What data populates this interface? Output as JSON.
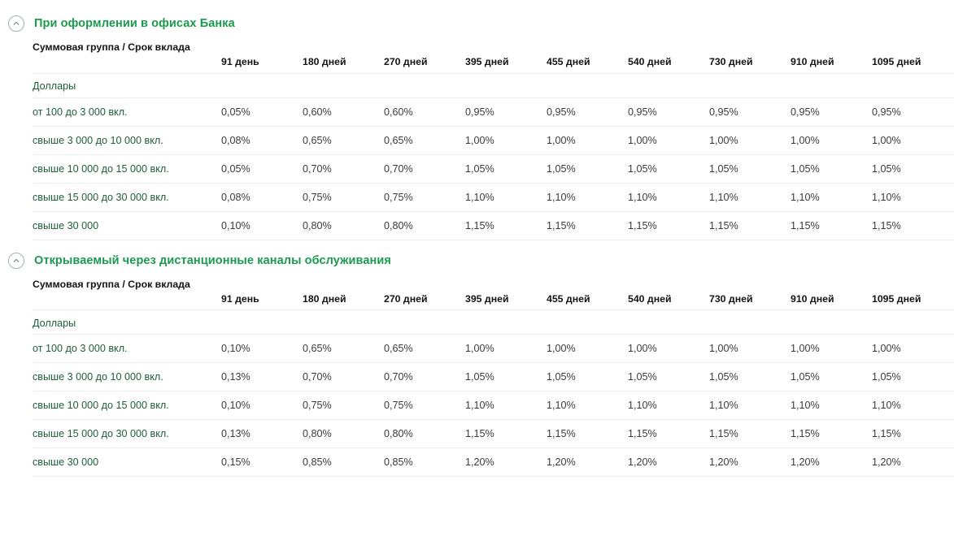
{
  "colors": {
    "heading_green": "#1a9b4c",
    "label_green": "#1d5e3a",
    "value_gray": "#3b3b3b",
    "header_dark": "#141414",
    "row_divider": "#eceff0",
    "icon_border": "#9db9a8"
  },
  "columns": [
    "Суммовая группа / Срок вклада",
    "91 день",
    "180 дней",
    "270 дней",
    "395 дней",
    "455 дней",
    "540 дней",
    "730 дней",
    "910 дней",
    "1095 дней"
  ],
  "sections": [
    {
      "id": "offices",
      "icon": "chevron-up-circle-icon",
      "title": "При оформлении в офисах Банка",
      "table": {
        "header": [
          "Суммовая группа / Срок вклада",
          "91 день",
          "180 дней",
          "270 дней",
          "395 дней",
          "455 дней",
          "540 дней",
          "730 дней",
          "910 дней",
          "1095 дней"
        ],
        "group_label": "Доллары",
        "rows": [
          {
            "label": "от 100 до 3 000 вкл.",
            "values": [
              "0,05%",
              "0,60%",
              "0,60%",
              "0,95%",
              "0,95%",
              "0,95%",
              "0,95%",
              "0,95%",
              "0,95%"
            ]
          },
          {
            "label": "свыше 3 000 до 10 000 вкл.",
            "values": [
              "0,08%",
              "0,65%",
              "0,65%",
              "1,00%",
              "1,00%",
              "1,00%",
              "1,00%",
              "1,00%",
              "1,00%"
            ]
          },
          {
            "label": "свыше 10 000 до 15 000 вкл.",
            "values": [
              "0,05%",
              "0,70%",
              "0,70%",
              "1,05%",
              "1,05%",
              "1,05%",
              "1,05%",
              "1,05%",
              "1,05%"
            ]
          },
          {
            "label": "свыше 15 000 до 30 000 вкл.",
            "values": [
              "0,08%",
              "0,75%",
              "0,75%",
              "1,10%",
              "1,10%",
              "1,10%",
              "1,10%",
              "1,10%",
              "1,10%"
            ]
          },
          {
            "label": "свыше 30 000",
            "values": [
              "0,10%",
              "0,80%",
              "0,80%",
              "1,15%",
              "1,15%",
              "1,15%",
              "1,15%",
              "1,15%",
              "1,15%"
            ]
          }
        ]
      }
    },
    {
      "id": "remote",
      "icon": "chevron-up-circle-icon",
      "title": "Открываемый через дистанционные каналы обслуживания",
      "table": {
        "header": [
          "Суммовая группа / Срок вклада",
          "91 день",
          "180 дней",
          "270 дней",
          "395 дней",
          "455 дней",
          "540 дней",
          "730 дней",
          "910 дней",
          "1095 дней"
        ],
        "group_label": "Доллары",
        "rows": [
          {
            "label": "от 100 до 3 000 вкл.",
            "values": [
              "0,10%",
              "0,65%",
              "0,65%",
              "1,00%",
              "1,00%",
              "1,00%",
              "1,00%",
              "1,00%",
              "1,00%"
            ]
          },
          {
            "label": "свыше 3 000 до 10 000 вкл.",
            "values": [
              "0,13%",
              "0,70%",
              "0,70%",
              "1,05%",
              "1,05%",
              "1,05%",
              "1,05%",
              "1,05%",
              "1,05%"
            ]
          },
          {
            "label": "свыше 10 000 до 15 000 вкл.",
            "values": [
              "0,10%",
              "0,75%",
              "0,75%",
              "1,10%",
              "1,10%",
              "1,10%",
              "1,10%",
              "1,10%",
              "1,10%"
            ]
          },
          {
            "label": "свыше 15 000 до 30 000 вкл.",
            "values": [
              "0,13%",
              "0,80%",
              "0,80%",
              "1,15%",
              "1,15%",
              "1,15%",
              "1,15%",
              "1,15%",
              "1,15%"
            ]
          },
          {
            "label": "свыше 30 000",
            "values": [
              "0,15%",
              "0,85%",
              "0,85%",
              "1,20%",
              "1,20%",
              "1,20%",
              "1,20%",
              "1,20%",
              "1,20%"
            ]
          }
        ]
      }
    }
  ]
}
